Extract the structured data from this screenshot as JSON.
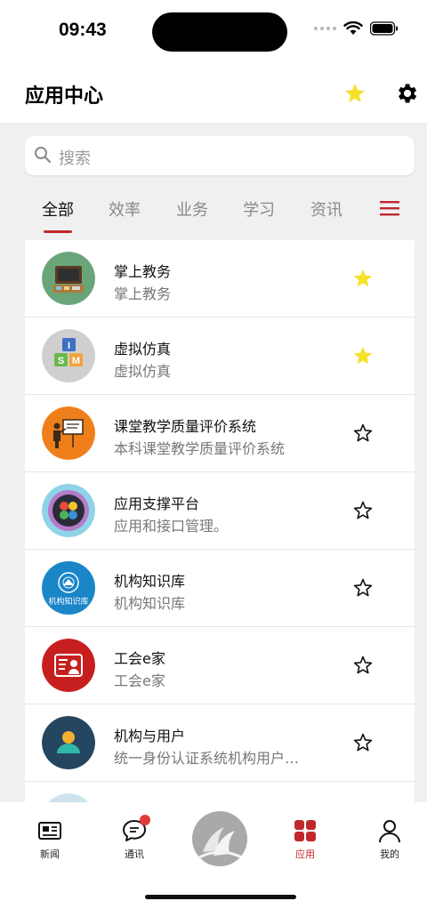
{
  "status_bar": {
    "time": "09:43"
  },
  "header": {
    "title": "应用中心"
  },
  "search": {
    "placeholder": "搜索"
  },
  "tabs": [
    {
      "label": "全部",
      "active": true
    },
    {
      "label": "效率"
    },
    {
      "label": "业务"
    },
    {
      "label": "学习"
    },
    {
      "label": "资讯"
    }
  ],
  "apps": [
    {
      "name": "掌上教务",
      "desc": "掌上教务",
      "favorite": true,
      "icon": "classroom-board-icon"
    },
    {
      "name": "虚拟仿真",
      "desc": "虚拟仿真",
      "favorite": true,
      "icon": "ism-blocks-icon"
    },
    {
      "name": "课堂教学质量评价系统",
      "desc": "本科课堂教学质量评价系统",
      "favorite": false,
      "icon": "teacher-board-icon"
    },
    {
      "name": "应用支撑平台",
      "desc": "应用和接口管理。",
      "favorite": false,
      "icon": "clover-platform-icon"
    },
    {
      "name": "机构知识库",
      "desc": "机构知识库",
      "favorite": false,
      "icon": "institution-repository-icon",
      "icon_text": "机构知识库"
    },
    {
      "name": "工会e家",
      "desc": "工会e家",
      "favorite": false,
      "icon": "union-card-icon"
    },
    {
      "name": "机构与用户",
      "desc": "统一身份认证系统机构用户…",
      "favorite": false,
      "icon": "user-person-icon"
    }
  ],
  "tabbar": [
    {
      "label": "新闻",
      "icon": "newspaper-icon"
    },
    {
      "label": "通讯",
      "icon": "chat-bubble-icon",
      "badge": true
    },
    {
      "label": "",
      "icon": "center-logo-icon"
    },
    {
      "label": "应用",
      "icon": "apps-grid-icon",
      "active": true
    },
    {
      "label": "我的",
      "icon": "person-icon"
    }
  ],
  "colors": {
    "accent": "#c0282d",
    "star_filled": "#f5e12a",
    "background": "#f0f0f0"
  }
}
